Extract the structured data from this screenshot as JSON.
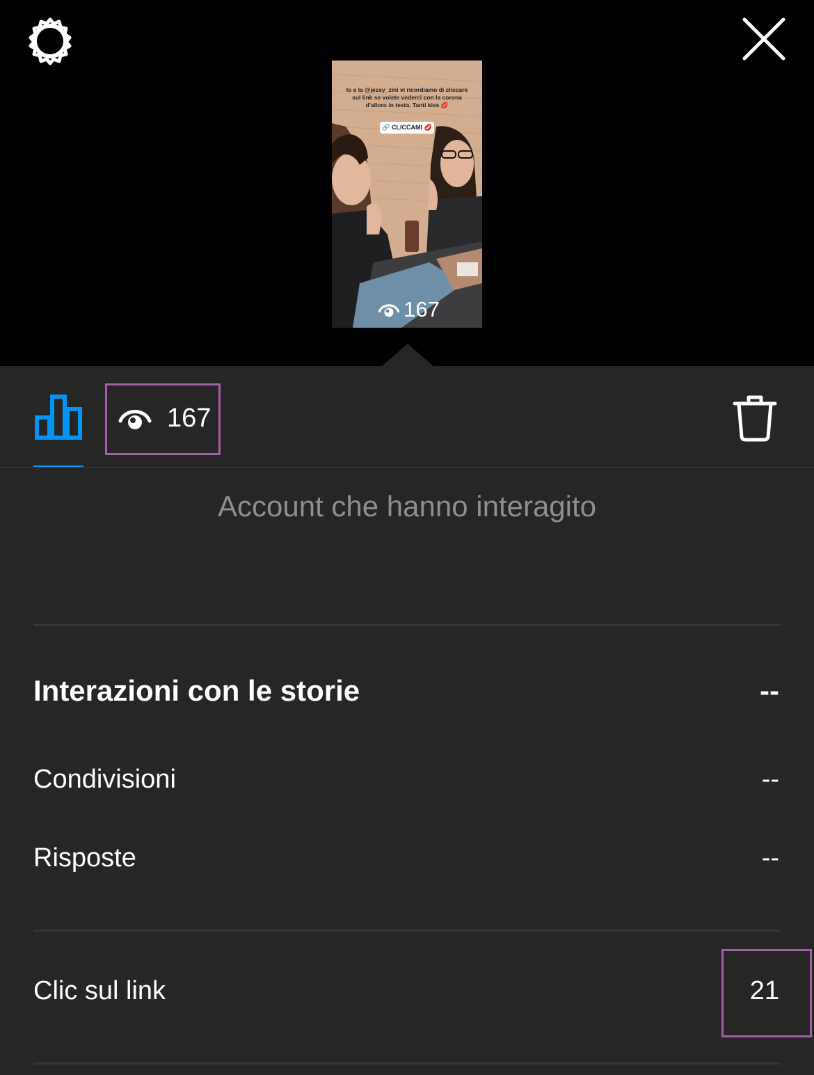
{
  "story": {
    "caption": "Io e la @jessy_zini vi ricordiamo di cliccare sul link se volete vederci con la corona d'alloro in testa. Tanti kiss 💋",
    "link_sticker": "🔗 CLICCAMI 💋",
    "views": "167"
  },
  "tabs": {
    "views_count": "167"
  },
  "accounts_interacted": {
    "title": "Account che hanno interagito"
  },
  "interactions": {
    "title": "Interazioni con le storie",
    "total": "--",
    "rows": [
      {
        "label": "Condivisioni",
        "value": "--"
      },
      {
        "label": "Risposte",
        "value": "--"
      }
    ]
  },
  "link_clicks": {
    "label": "Clic sul link",
    "value": "21"
  },
  "colors": {
    "accent": "#0095f6",
    "highlight": "#a25fa8",
    "background": "#262626"
  },
  "icons": [
    "gear-icon",
    "close-icon",
    "bar-chart-icon",
    "eye-icon",
    "trash-icon"
  ]
}
